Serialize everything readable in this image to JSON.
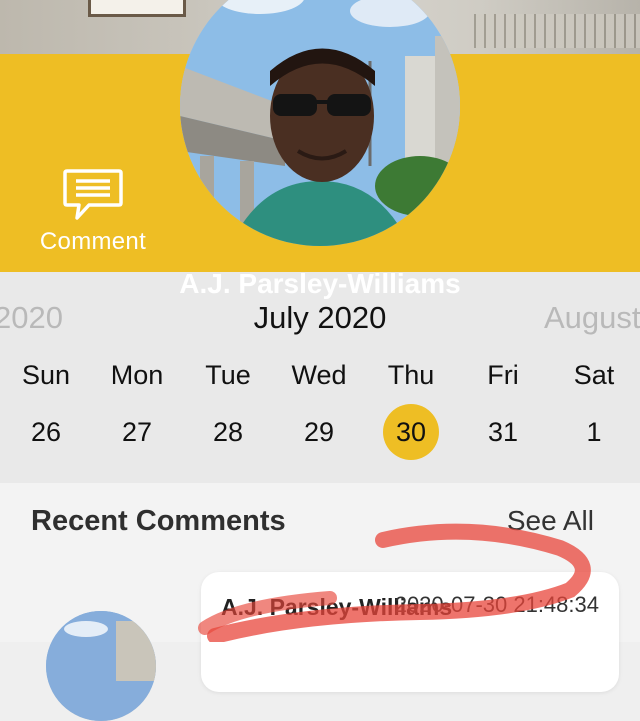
{
  "profile": {
    "name": "A.J. Parsley-Williams",
    "comment_label": "Comment",
    "comment_icon": "chat-bubble-icon"
  },
  "calendar": {
    "prev_month": "2020",
    "current_month": "July 2020",
    "next_month": "August",
    "weekdays": [
      "Sun",
      "Mon",
      "Tue",
      "Wed",
      "Thu",
      "Fri",
      "Sat"
    ],
    "days": [
      "26",
      "27",
      "28",
      "29",
      "30",
      "31",
      "1"
    ],
    "selected_day": "30"
  },
  "recent": {
    "title": "Recent Comments",
    "see_all": "See All",
    "items": [
      {
        "author": "A.J. Parsley-Williams",
        "timestamp": "2020-07-30 21:48:34"
      }
    ]
  },
  "colors": {
    "accent": "#eebe24",
    "calendar_bg": "#e9e9e9",
    "section_bg": "#f3f3f3",
    "annotation": "#e8463b"
  }
}
